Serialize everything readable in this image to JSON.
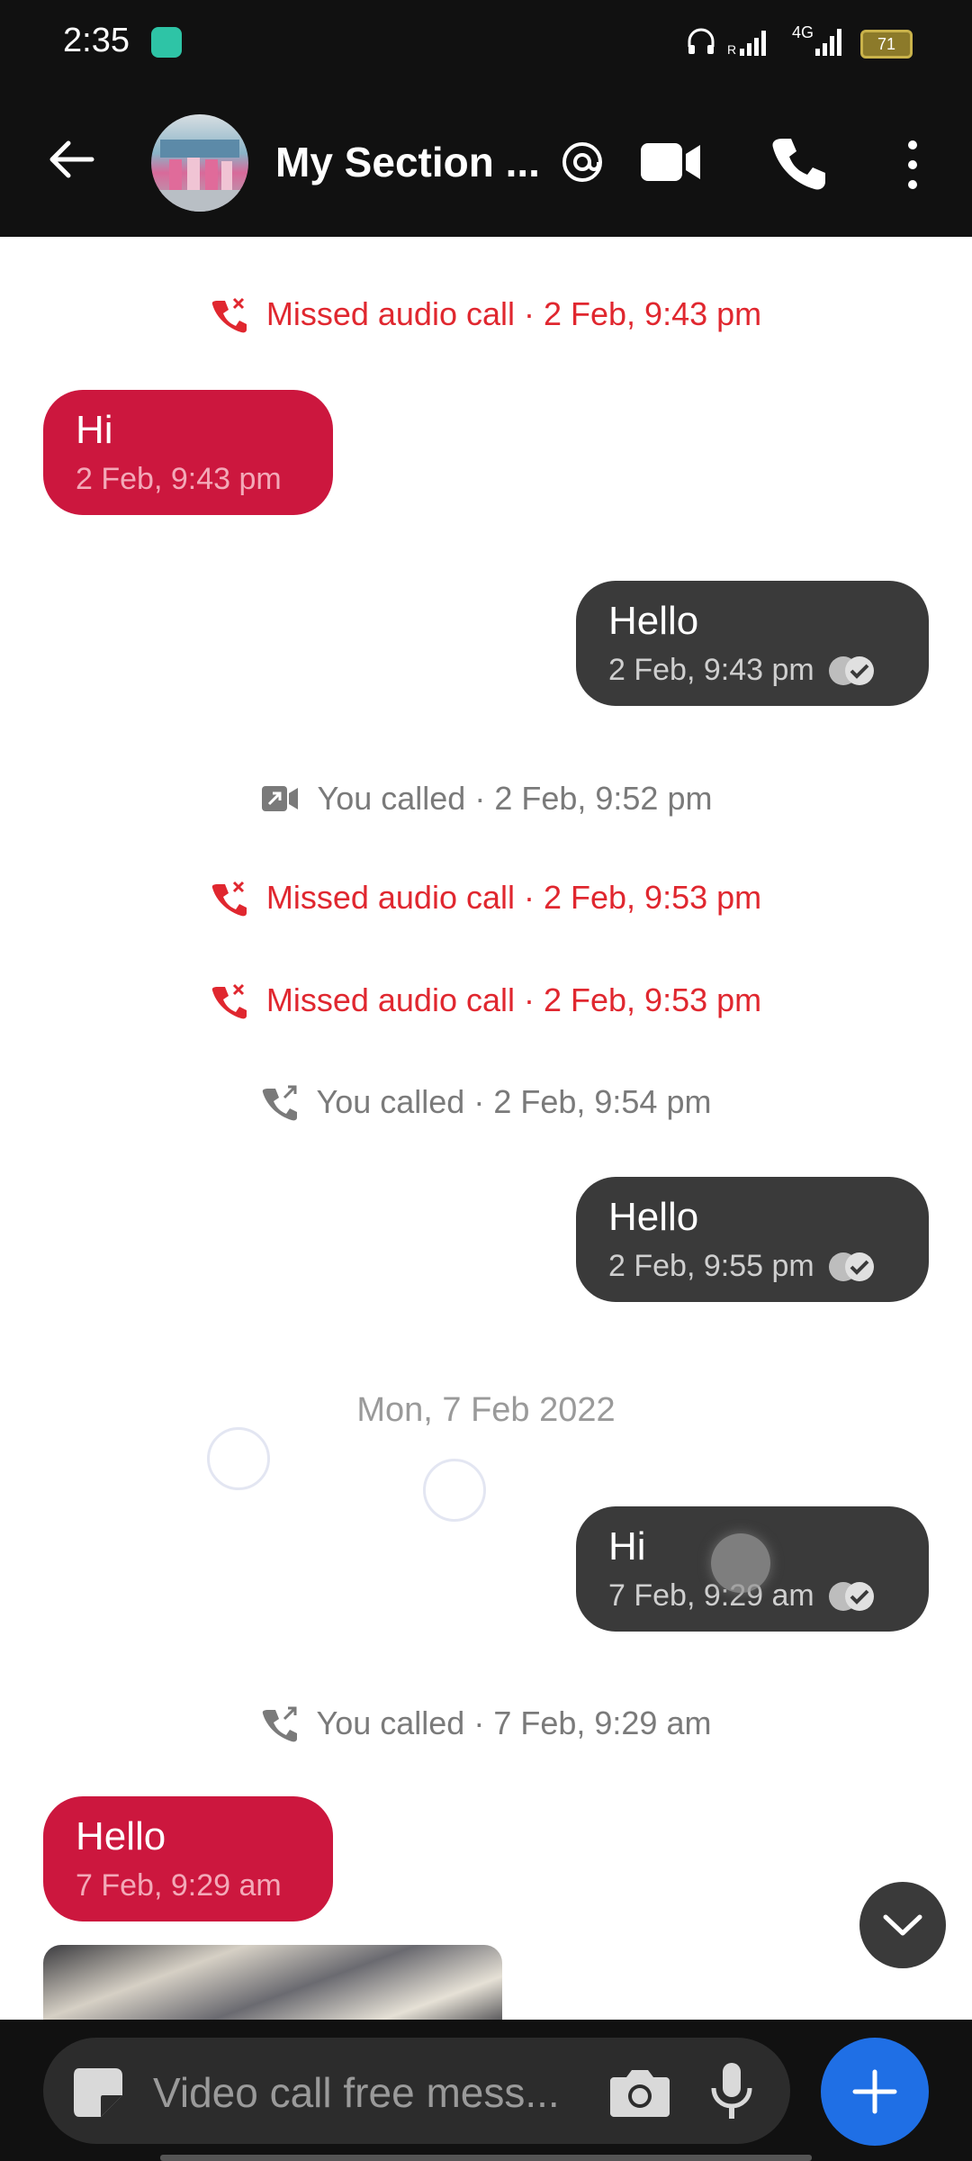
{
  "status_bar": {
    "time": "2:35",
    "network": "4G",
    "battery": "71"
  },
  "header": {
    "title": "My Section ..."
  },
  "messages": {
    "m1": {
      "text": "Missed audio call · 2 Feb, 9:43 pm"
    },
    "m2": {
      "text": "Hi",
      "time": "2 Feb, 9:43 pm"
    },
    "m3": {
      "text": "Hello",
      "time": "2 Feb, 9:43 pm"
    },
    "m4": {
      "text": "You called · 2 Feb, 9:52 pm"
    },
    "m5": {
      "text": "Missed audio call · 2 Feb, 9:53 pm"
    },
    "m6": {
      "text": "Missed audio call · 2 Feb, 9:53 pm"
    },
    "m7": {
      "text": "You called · 2 Feb, 9:54 pm"
    },
    "m8": {
      "text": "Hello",
      "time": "2 Feb, 9:55 pm"
    },
    "date_separator": "Mon, 7 Feb 2022",
    "m9": {
      "text": "Hi",
      "time": "7 Feb, 9:29 am"
    },
    "m10": {
      "text": "You called · 7 Feb, 9:29 am"
    },
    "m11": {
      "text": "Hello",
      "time": "7 Feb, 9:29 am"
    }
  },
  "composer": {
    "placeholder": "Video call free mess..."
  },
  "colors": {
    "incoming": "#cc173e",
    "outgoing": "#3a3a3a",
    "missed": "#e0272f",
    "fab": "#1f6fe5"
  }
}
